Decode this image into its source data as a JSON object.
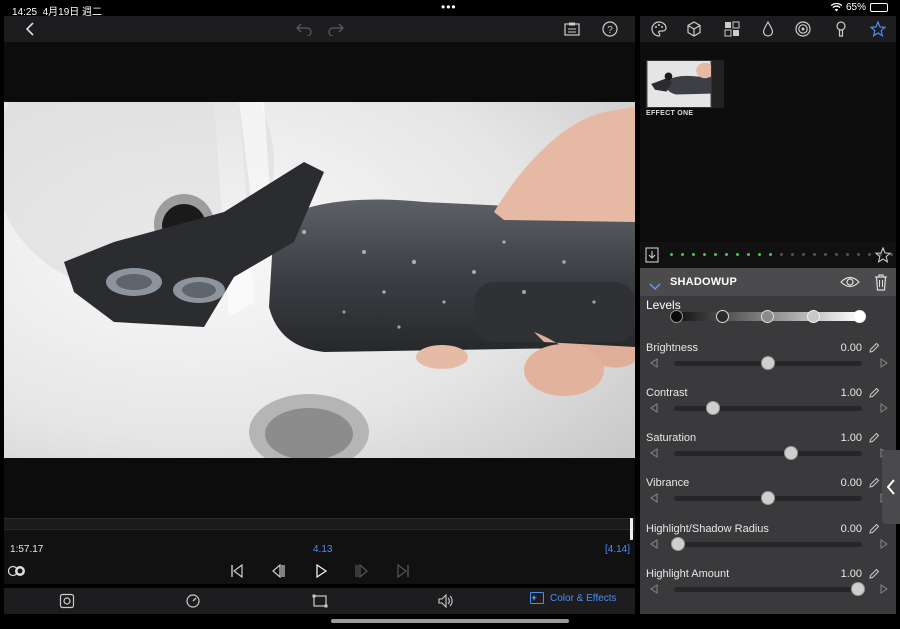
{
  "status_bar": {
    "time": "14:25",
    "date": "4月19日 週二",
    "dots": "•••",
    "battery": "65%",
    "battery_level": 0.65
  },
  "top_toolbar": {
    "icons": [
      "back-chevron-icon",
      "undo-icon",
      "redo-icon",
      "clipboard-icon",
      "help-icon"
    ]
  },
  "right_toolbar": {
    "icons": [
      "palette-icon",
      "cube-icon",
      "grid-icon",
      "droplet-icon",
      "spiral-icon",
      "keyhole-icon",
      "star-icon"
    ],
    "active": "star-icon"
  },
  "effects": {
    "items": [
      {
        "label": "EFFECT ONE"
      }
    ]
  },
  "panel": {
    "title": "SHADOWUP",
    "levels_label": "Levels",
    "parameters": [
      {
        "name": "Brightness",
        "value": "0.00",
        "position": 0.5
      },
      {
        "name": "Contrast",
        "value": "1.00",
        "position": 0.21
      },
      {
        "name": "Saturation",
        "value": "1.00",
        "position": 0.62
      },
      {
        "name": "Vibrance",
        "value": "0.00",
        "position": 0.5
      },
      {
        "name": "Highlight/Shadow Radius",
        "value": "0.00",
        "position": 0.02
      },
      {
        "name": "Highlight Amount",
        "value": "1.00",
        "position": 0.98
      }
    ]
  },
  "timeline": {
    "current_time": "1:57.17",
    "center_value": "4.13",
    "right_value": "[4.14]"
  },
  "bottom_bar": {
    "color_effects_label": "Color & Effects"
  },
  "colors": {
    "accent": "#4c8df5",
    "panel_bg": "#3a3a3c",
    "toolbar_bg": "#1d1d1f",
    "meter_green": "#46c74b",
    "meter_red": "#e03a3a"
  }
}
